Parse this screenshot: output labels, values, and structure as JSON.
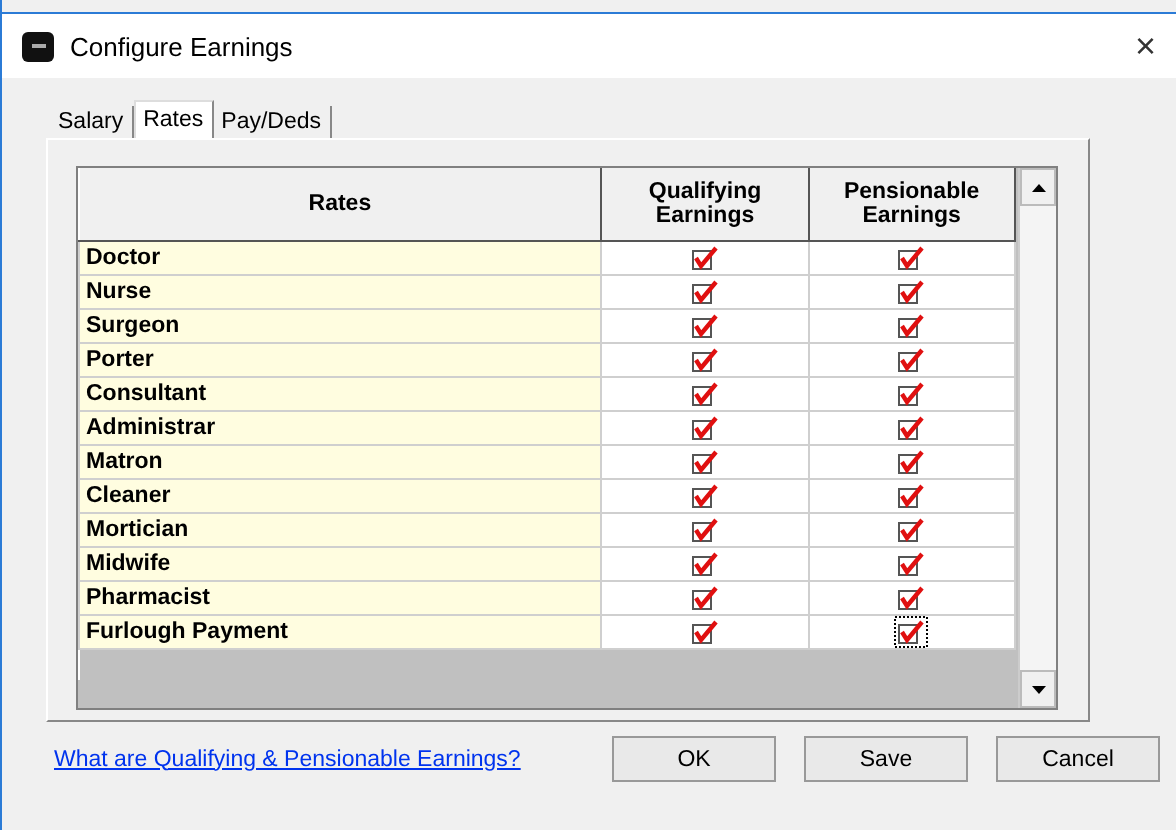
{
  "window": {
    "title": "Configure Earnings",
    "close": "×"
  },
  "tabs": [
    {
      "label": "Salary",
      "selected": false
    },
    {
      "label": "Rates",
      "selected": true
    },
    {
      "label": "Pay/Deds",
      "selected": false
    }
  ],
  "grid": {
    "columns": [
      "Rates",
      "Qualifying Earnings",
      "Pensionable Earnings"
    ],
    "rows": [
      {
        "name": "Doctor",
        "cells": [
          {
            "checked": true,
            "focused": false
          },
          {
            "checked": true,
            "focused": false
          }
        ]
      },
      {
        "name": "Nurse",
        "cells": [
          {
            "checked": true,
            "focused": false
          },
          {
            "checked": true,
            "focused": false
          }
        ]
      },
      {
        "name": "Surgeon",
        "cells": [
          {
            "checked": true,
            "focused": false
          },
          {
            "checked": true,
            "focused": false
          }
        ]
      },
      {
        "name": "Porter",
        "cells": [
          {
            "checked": true,
            "focused": false
          },
          {
            "checked": true,
            "focused": false
          }
        ]
      },
      {
        "name": "Consultant",
        "cells": [
          {
            "checked": true,
            "focused": false
          },
          {
            "checked": true,
            "focused": false
          }
        ]
      },
      {
        "name": "Administrar",
        "cells": [
          {
            "checked": true,
            "focused": false
          },
          {
            "checked": true,
            "focused": false
          }
        ]
      },
      {
        "name": "Matron",
        "cells": [
          {
            "checked": true,
            "focused": false
          },
          {
            "checked": true,
            "focused": false
          }
        ]
      },
      {
        "name": "Cleaner",
        "cells": [
          {
            "checked": true,
            "focused": false
          },
          {
            "checked": true,
            "focused": false
          }
        ]
      },
      {
        "name": "Mortician",
        "cells": [
          {
            "checked": true,
            "focused": false
          },
          {
            "checked": true,
            "focused": false
          }
        ]
      },
      {
        "name": "Midwife",
        "cells": [
          {
            "checked": true,
            "focused": false
          },
          {
            "checked": true,
            "focused": false
          }
        ]
      },
      {
        "name": "Pharmacist",
        "cells": [
          {
            "checked": true,
            "focused": false
          },
          {
            "checked": true,
            "focused": false
          }
        ]
      },
      {
        "name": "Furlough Payment",
        "cells": [
          {
            "checked": true,
            "focused": false
          },
          {
            "checked": true,
            "focused": true
          }
        ]
      }
    ]
  },
  "help_link": "What are Qualifying & Pensionable Earnings?",
  "buttons": [
    {
      "label": "OK"
    },
    {
      "label": "Save"
    },
    {
      "label": "Cancel"
    }
  ]
}
